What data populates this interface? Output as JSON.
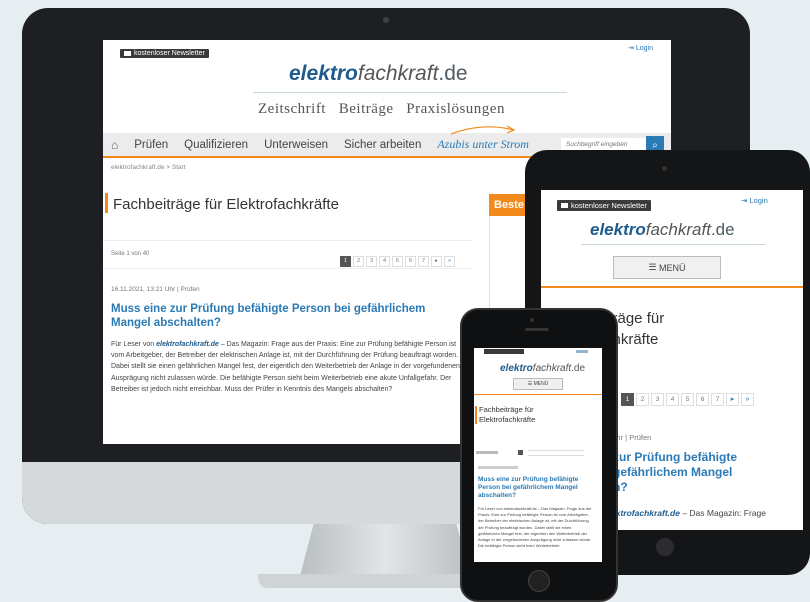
{
  "desktop": {
    "newsletter_label": "kostenloser Newsletter",
    "login_label": "Login",
    "logo": {
      "bold": "elektro",
      "italic": "fachkraft",
      "tld": ".de"
    },
    "subnav": [
      "Zeitschrift",
      "Beiträge",
      "Praxislösungen"
    ],
    "nav_items": [
      "Prüfen",
      "Qualifizieren",
      "Unterweisen",
      "Sicher arbeiten"
    ],
    "nav_special": "Azubis unter Strom",
    "search_placeholder": "Suchbegriff eingeben",
    "breadcrumb": "elektrofachkraft.de > Start",
    "page_title": "Fachbeiträge für Elektrofachkräfte",
    "sidebar_title": "Beste",
    "page_info": "Seite 1 von 40",
    "pages": [
      "1",
      "2",
      "3",
      "4",
      "5",
      "6",
      "7"
    ],
    "article_meta": "16.11.2021, 13:21 Uhr | Prüfen",
    "article_title": "Muss eine zur Prüfung befähigte Person bei gefährlichem Mangel abschalten?",
    "article_source": "elektrofachkraft.de",
    "article_text": " – Das Magazin: Frage aus der Praxis: Eine zur Prüfung befähigte Person ist vom Arbeitgeber, der Betreiber der elektrischen Anlage ist, mit der Durchführung der Prüfung beauftragt worden. Dabei stellt sie einen gefährlichen Mangel fest, der eigentlich den Weiterbetrieb der Anlage in der vorgefundenen Ausprägung nicht zulassen würde. Die befähigte Person sieht beim Weiterbetrieb eine akute Unfallgefahr. Der Betreiber ist jedoch nicht erreichbar. Muss der Prüfer in Kenntnis des Mangels abschalten?",
    "reader_prefix": "Für Leser von "
  },
  "tablet": {
    "newsletter_label": "kostenloser Newsletter",
    "login_label": "Login",
    "menu_label": "MENÜ",
    "title_partial_1": "iträge für",
    "title_partial_2": "chkräfte",
    "pages": [
      "1",
      "2",
      "3",
      "4",
      "5",
      "6",
      "7"
    ],
    "meta_partial": "Uhr | Prüfen",
    "article_title_1": "zur Prüfung befähigte",
    "article_title_2": "gefährlichem Mangel",
    "article_title_3": "n?",
    "source_partial": "ektrofachkraft.de",
    "source_suffix": " – Das Magazin: Frage"
  },
  "phone": {
    "menu_label": "MENÜ",
    "page_title": "Fachbeiträge für Elektrofachkräfte",
    "article_title": "Muss eine zur Prüfung befähigte Person bei gefährlichem Mangel abschalten?",
    "article_text": "Für Leser von elektrofachkraft.de – Das Magazin: Frage aus der Praxis: Eine zur Prüfung befähigte Person ist vom Arbeitgeber, der Betreiber der elektrischen Anlage ist, mit der Durchführung der Prüfung beauftragt worden. Dabei stellt sie einen gefährlichen Mangel fest, der eigentlich den Weiterbetrieb der Anlage in der vorgefundenen Ausprägung nicht zulassen würde. Die befähigte Person sieht beim Weiterbetrieb"
  },
  "colors": {
    "accent_blue": "#2a7ab5",
    "accent_orange": "#f28a1b",
    "logo_blue": "#1f5b8c"
  }
}
